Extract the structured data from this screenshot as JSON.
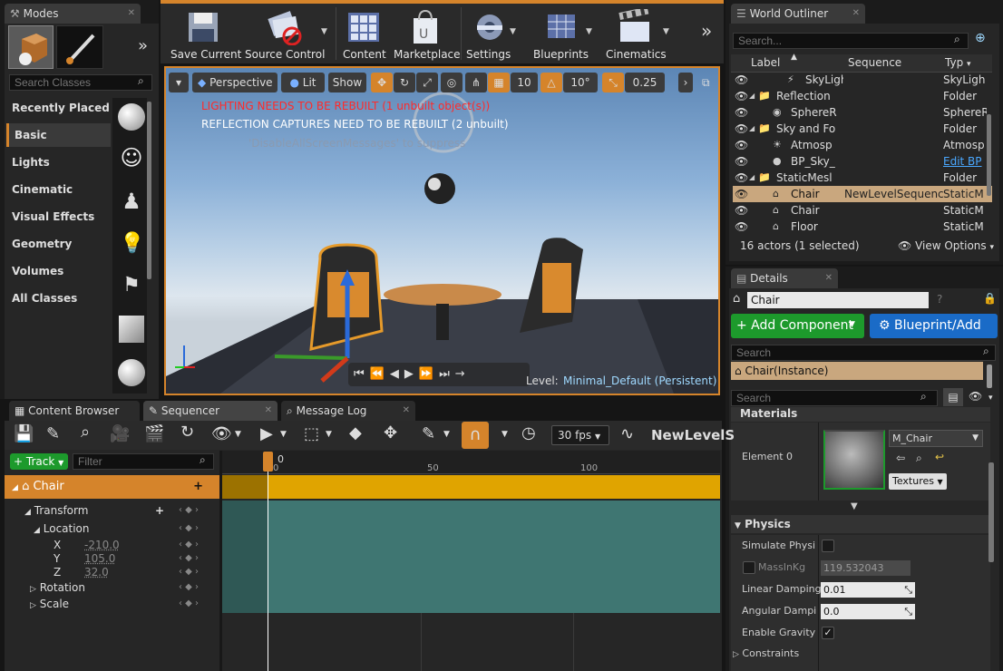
{
  "modes": {
    "tab": "Modes",
    "search_placeholder": "Search Classes",
    "categories": [
      "Recently Placed",
      "Basic",
      "Lights",
      "Cinematic",
      "Visual Effects",
      "Geometry",
      "Volumes",
      "All Classes"
    ],
    "selected": "Basic"
  },
  "toolbar": {
    "save_current": "Save Current",
    "source_control": "Source Control",
    "content": "Content",
    "marketplace": "Marketplace",
    "settings": "Settings",
    "blueprints": "Blueprints",
    "cinematics": "Cinematics"
  },
  "viewport": {
    "perspective": "Perspective",
    "lit": "Lit",
    "show": "Show",
    "grid_snap": "10",
    "rot_snap": "10°",
    "scale_snap": "0.25",
    "warning_lighting": "LIGHTING NEEDS TO BE REBUILT (1 unbuilt object(s))",
    "warning_reflection": "REFLECTION CAPTURES NEED TO BE REBUILT (2 unbuilt)",
    "suppress_hint": "'DisableAllScreenMessages' to suppress",
    "level_label": "Level:",
    "level_name": "Minimal_Default (Persistent)"
  },
  "outliner": {
    "tab": "World Outliner",
    "search_placeholder": "Search...",
    "col_label": "Label",
    "col_sequence": "Sequence",
    "col_type": "Typ",
    "rows": [
      {
        "label": "SkyLigh",
        "seq": "",
        "type": "SkyLigh"
      },
      {
        "label": "Reflection",
        "seq": "",
        "type": "Folder"
      },
      {
        "label": "SphereR",
        "seq": "",
        "type": "SphereR"
      },
      {
        "label": "Sky and Fo",
        "seq": "",
        "type": "Folder"
      },
      {
        "label": "Atmosp",
        "seq": "",
        "type": "Atmosp"
      },
      {
        "label": "BP_Sky_",
        "seq": "",
        "type": "Edit BP"
      },
      {
        "label": "StaticMesl",
        "seq": "",
        "type": "Folder"
      },
      {
        "label": "Chair",
        "seq": "NewLevelSequence",
        "type": "StaticM"
      },
      {
        "label": "Chair",
        "seq": "",
        "type": "StaticM"
      },
      {
        "label": "Floor",
        "seq": "",
        "type": "StaticM"
      }
    ],
    "status": "16 actors (1 selected)",
    "view_options": "View Options"
  },
  "details": {
    "tab": "Details",
    "name": "Chair",
    "add_component": "+ Add Component",
    "blueprint_add": "Blueprint/Add",
    "search_placeholder": "Search",
    "instance": "Chair(Instance)",
    "search2_placeholder": "Search",
    "materials_header": "Materials",
    "element0": "Element 0",
    "material_name": "M_Chair",
    "textures_btn": "Textures",
    "physics_header": "Physics",
    "simulate_physics": "Simulate Physi",
    "mass_in_kg": "MassInKg",
    "mass_value": "119.532043",
    "linear_damping": "Linear Damping",
    "linear_value": "0.01",
    "angular_damping": "Angular Dampi",
    "angular_value": "0.0",
    "enable_gravity": "Enable Gravity",
    "constraints": "Constraints"
  },
  "bottom_tabs": {
    "content_browser": "Content Browser",
    "sequencer": "Sequencer",
    "message_log": "Message Log"
  },
  "sequencer": {
    "fps": "30 fps",
    "sequence_name": "NewLevelS",
    "track_btn": "Track",
    "filter_placeholder": "Filter",
    "actor": "Chair",
    "transform": "Transform",
    "location": "Location",
    "x_label": "X",
    "x_value": "-210.0",
    "y_label": "Y",
    "y_value": "105.0",
    "z_label": "Z",
    "z_value": "32.0",
    "rotation": "Rotation",
    "scale": "Scale",
    "ruler": [
      "0",
      "50",
      "100"
    ],
    "playhead": "0"
  },
  "colors": {
    "accent_orange": "#d5842b",
    "green_button": "#1d9a2c",
    "blue_button": "#1a6bc7",
    "warning_red": "#ff2a2a"
  }
}
